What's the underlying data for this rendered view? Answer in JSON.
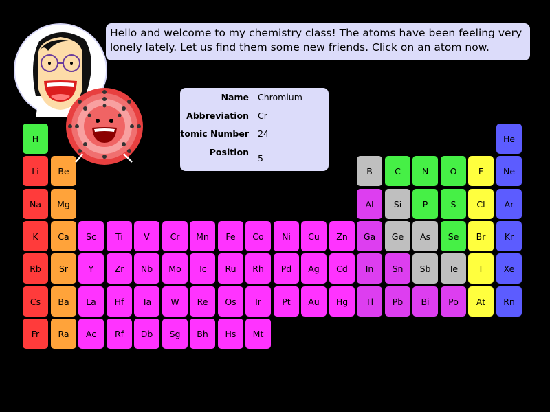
{
  "speech": {
    "line1": "Hello and welcome to my chemistry class! The atoms have been feeling very",
    "line2": "lonely lately. Let us find them some new friends. Click on an atom now."
  },
  "info": {
    "name_label": "Name",
    "name_value": "Chromium",
    "abbr_label": "Abbreviation",
    "abbr_value": "Cr",
    "number_label": "Atomic Number",
    "number_value": "24",
    "position_label": "Position",
    "position_value": "5"
  },
  "colors": {
    "alkali": "#ff3b3b",
    "alkaline": "#ffa33a",
    "transition": "#ff33ff",
    "post": "#dd3ef0",
    "metalloid": "#bfbfbf",
    "nonmetal": "#46f046",
    "halogen": "#ffff3e",
    "noble": "#5c5cff"
  },
  "elements": [
    {
      "sym": "H",
      "row": 1,
      "col": 1,
      "cat": "nonmetal"
    },
    {
      "sym": "He",
      "row": 1,
      "col": 18,
      "cat": "noble"
    },
    {
      "sym": "Li",
      "row": 2,
      "col": 1,
      "cat": "alkali"
    },
    {
      "sym": "Be",
      "row": 2,
      "col": 2,
      "cat": "alkaline"
    },
    {
      "sym": "B",
      "row": 2,
      "col": 13,
      "cat": "metalloid"
    },
    {
      "sym": "C",
      "row": 2,
      "col": 14,
      "cat": "nonmetal"
    },
    {
      "sym": "N",
      "row": 2,
      "col": 15,
      "cat": "nonmetal"
    },
    {
      "sym": "O",
      "row": 2,
      "col": 16,
      "cat": "nonmetal"
    },
    {
      "sym": "F",
      "row": 2,
      "col": 17,
      "cat": "halogen"
    },
    {
      "sym": "Ne",
      "row": 2,
      "col": 18,
      "cat": "noble"
    },
    {
      "sym": "Na",
      "row": 3,
      "col": 1,
      "cat": "alkali"
    },
    {
      "sym": "Mg",
      "row": 3,
      "col": 2,
      "cat": "alkaline"
    },
    {
      "sym": "Al",
      "row": 3,
      "col": 13,
      "cat": "post"
    },
    {
      "sym": "Si",
      "row": 3,
      "col": 14,
      "cat": "metalloid"
    },
    {
      "sym": "P",
      "row": 3,
      "col": 15,
      "cat": "nonmetal"
    },
    {
      "sym": "S",
      "row": 3,
      "col": 16,
      "cat": "nonmetal"
    },
    {
      "sym": "Cl",
      "row": 3,
      "col": 17,
      "cat": "halogen"
    },
    {
      "sym": "Ar",
      "row": 3,
      "col": 18,
      "cat": "noble"
    },
    {
      "sym": "K",
      "row": 4,
      "col": 1,
      "cat": "alkali"
    },
    {
      "sym": "Ca",
      "row": 4,
      "col": 2,
      "cat": "alkaline"
    },
    {
      "sym": "Sc",
      "row": 4,
      "col": 3,
      "cat": "transition"
    },
    {
      "sym": "Ti",
      "row": 4,
      "col": 4,
      "cat": "transition"
    },
    {
      "sym": "V",
      "row": 4,
      "col": 5,
      "cat": "transition"
    },
    {
      "sym": "Cr",
      "row": 4,
      "col": 6,
      "cat": "transition"
    },
    {
      "sym": "Mn",
      "row": 4,
      "col": 7,
      "cat": "transition"
    },
    {
      "sym": "Fe",
      "row": 4,
      "col": 8,
      "cat": "transition"
    },
    {
      "sym": "Co",
      "row": 4,
      "col": 9,
      "cat": "transition"
    },
    {
      "sym": "Ni",
      "row": 4,
      "col": 10,
      "cat": "transition"
    },
    {
      "sym": "Cu",
      "row": 4,
      "col": 11,
      "cat": "transition"
    },
    {
      "sym": "Zn",
      "row": 4,
      "col": 12,
      "cat": "transition"
    },
    {
      "sym": "Ga",
      "row": 4,
      "col": 13,
      "cat": "post"
    },
    {
      "sym": "Ge",
      "row": 4,
      "col": 14,
      "cat": "metalloid"
    },
    {
      "sym": "As",
      "row": 4,
      "col": 15,
      "cat": "metalloid"
    },
    {
      "sym": "Se",
      "row": 4,
      "col": 16,
      "cat": "nonmetal"
    },
    {
      "sym": "Br",
      "row": 4,
      "col": 17,
      "cat": "halogen"
    },
    {
      "sym": "Kr",
      "row": 4,
      "col": 18,
      "cat": "noble"
    },
    {
      "sym": "Rb",
      "row": 5,
      "col": 1,
      "cat": "alkali"
    },
    {
      "sym": "Sr",
      "row": 5,
      "col": 2,
      "cat": "alkaline"
    },
    {
      "sym": "Y",
      "row": 5,
      "col": 3,
      "cat": "transition"
    },
    {
      "sym": "Zr",
      "row": 5,
      "col": 4,
      "cat": "transition"
    },
    {
      "sym": "Nb",
      "row": 5,
      "col": 5,
      "cat": "transition"
    },
    {
      "sym": "Mo",
      "row": 5,
      "col": 6,
      "cat": "transition"
    },
    {
      "sym": "Tc",
      "row": 5,
      "col": 7,
      "cat": "transition"
    },
    {
      "sym": "Ru",
      "row": 5,
      "col": 8,
      "cat": "transition"
    },
    {
      "sym": "Rh",
      "row": 5,
      "col": 9,
      "cat": "transition"
    },
    {
      "sym": "Pd",
      "row": 5,
      "col": 10,
      "cat": "transition"
    },
    {
      "sym": "Ag",
      "row": 5,
      "col": 11,
      "cat": "transition"
    },
    {
      "sym": "Cd",
      "row": 5,
      "col": 12,
      "cat": "transition"
    },
    {
      "sym": "In",
      "row": 5,
      "col": 13,
      "cat": "post"
    },
    {
      "sym": "Sn",
      "row": 5,
      "col": 14,
      "cat": "post"
    },
    {
      "sym": "Sb",
      "row": 5,
      "col": 15,
      "cat": "metalloid"
    },
    {
      "sym": "Te",
      "row": 5,
      "col": 16,
      "cat": "metalloid"
    },
    {
      "sym": "I",
      "row": 5,
      "col": 17,
      "cat": "halogen"
    },
    {
      "sym": "Xe",
      "row": 5,
      "col": 18,
      "cat": "noble"
    },
    {
      "sym": "Cs",
      "row": 6,
      "col": 1,
      "cat": "alkali"
    },
    {
      "sym": "Ba",
      "row": 6,
      "col": 2,
      "cat": "alkaline"
    },
    {
      "sym": "La",
      "row": 6,
      "col": 3,
      "cat": "transition"
    },
    {
      "sym": "Hf",
      "row": 6,
      "col": 4,
      "cat": "transition"
    },
    {
      "sym": "Ta",
      "row": 6,
      "col": 5,
      "cat": "transition"
    },
    {
      "sym": "W",
      "row": 6,
      "col": 6,
      "cat": "transition"
    },
    {
      "sym": "Re",
      "row": 6,
      "col": 7,
      "cat": "transition"
    },
    {
      "sym": "Os",
      "row": 6,
      "col": 8,
      "cat": "transition"
    },
    {
      "sym": "Ir",
      "row": 6,
      "col": 9,
      "cat": "transition"
    },
    {
      "sym": "Pt",
      "row": 6,
      "col": 10,
      "cat": "transition"
    },
    {
      "sym": "Au",
      "row": 6,
      "col": 11,
      "cat": "transition"
    },
    {
      "sym": "Hg",
      "row": 6,
      "col": 12,
      "cat": "transition"
    },
    {
      "sym": "Tl",
      "row": 6,
      "col": 13,
      "cat": "post"
    },
    {
      "sym": "Pb",
      "row": 6,
      "col": 14,
      "cat": "post"
    },
    {
      "sym": "Bi",
      "row": 6,
      "col": 15,
      "cat": "post"
    },
    {
      "sym": "Po",
      "row": 6,
      "col": 16,
      "cat": "post"
    },
    {
      "sym": "At",
      "row": 6,
      "col": 17,
      "cat": "halogen"
    },
    {
      "sym": "Rn",
      "row": 6,
      "col": 18,
      "cat": "noble"
    },
    {
      "sym": "Fr",
      "row": 7,
      "col": 1,
      "cat": "alkali"
    },
    {
      "sym": "Ra",
      "row": 7,
      "col": 2,
      "cat": "alkaline"
    },
    {
      "sym": "Ac",
      "row": 7,
      "col": 3,
      "cat": "transition"
    },
    {
      "sym": "Rf",
      "row": 7,
      "col": 4,
      "cat": "transition"
    },
    {
      "sym": "Db",
      "row": 7,
      "col": 5,
      "cat": "transition"
    },
    {
      "sym": "Sg",
      "row": 7,
      "col": 6,
      "cat": "transition"
    },
    {
      "sym": "Bh",
      "row": 7,
      "col": 7,
      "cat": "transition"
    },
    {
      "sym": "Hs",
      "row": 7,
      "col": 8,
      "cat": "transition"
    },
    {
      "sym": "Mt",
      "row": 7,
      "col": 9,
      "cat": "transition"
    }
  ]
}
